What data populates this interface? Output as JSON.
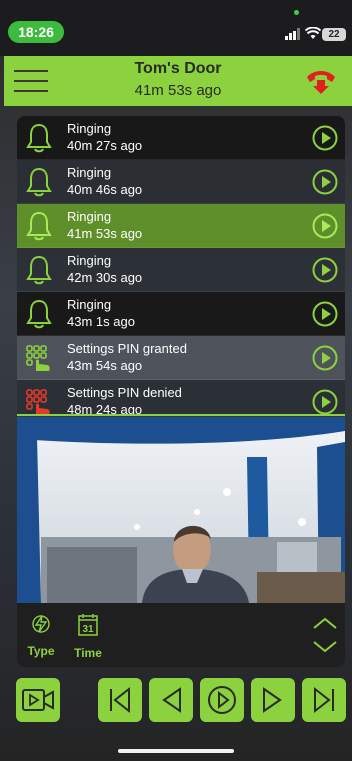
{
  "status_bar": {
    "time": "18:26",
    "battery": "22"
  },
  "header": {
    "title": "Tom's Door",
    "subtitle": "41m 53s ago"
  },
  "events": [
    {
      "title": "Ringing",
      "time": "40m 27s ago",
      "icon": "bell-icon",
      "state": "dark"
    },
    {
      "title": "Ringing",
      "time": "40m 46s ago",
      "icon": "bell-icon",
      "state": "mid"
    },
    {
      "title": "Ringing",
      "time": "41m 53s ago",
      "icon": "bell-icon",
      "state": "selected"
    },
    {
      "title": "Ringing",
      "time": "42m 30s ago",
      "icon": "bell-icon",
      "state": "mid"
    },
    {
      "title": "Ringing",
      "time": "43m 1s ago",
      "icon": "bell-icon",
      "state": "dark"
    },
    {
      "title": "Settings PIN granted",
      "time": "43m 54s ago",
      "icon": "keypad-granted-icon",
      "state": "light"
    },
    {
      "title": "Settings PIN denied",
      "time": "48m 24s ago",
      "icon": "keypad-denied-icon",
      "state": "mid"
    }
  ],
  "filters": {
    "type_label": "Type",
    "time_label": "Time",
    "calendar_day": "31"
  },
  "colors": {
    "accent": "#8bd23e",
    "hangup": "#e02020",
    "denied": "#e53a2a"
  }
}
